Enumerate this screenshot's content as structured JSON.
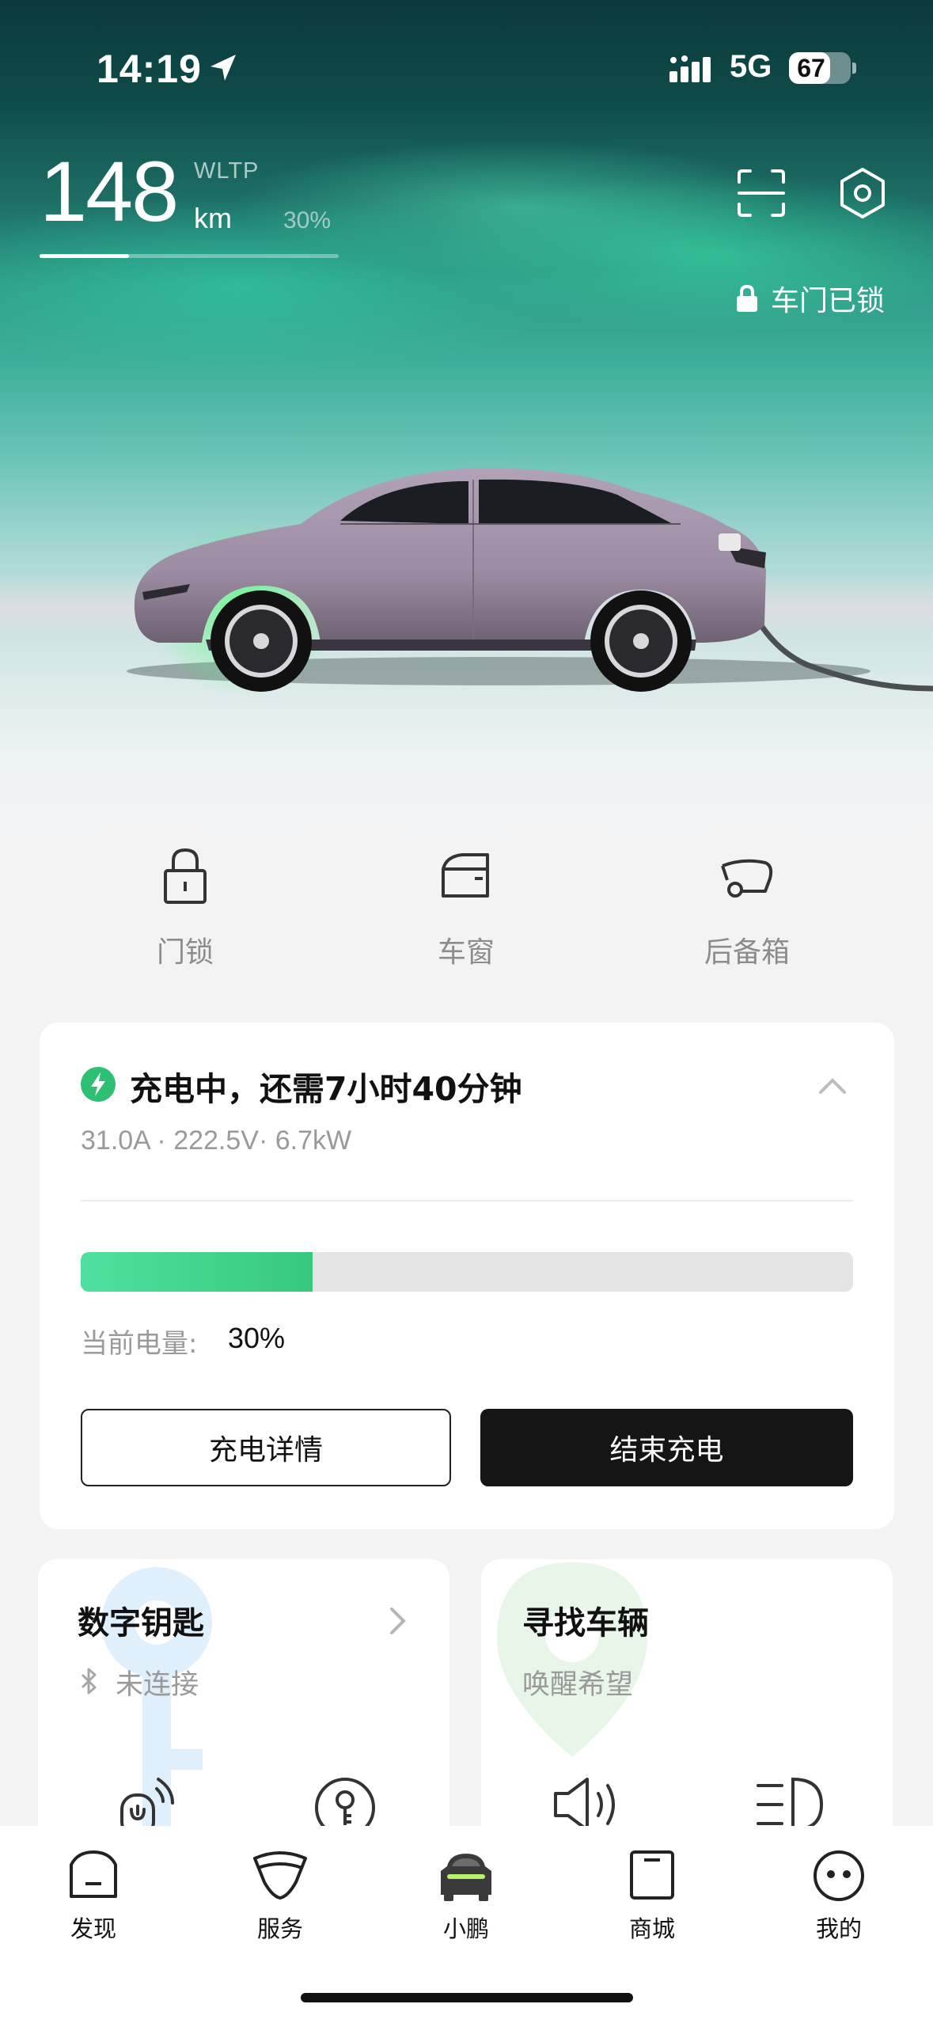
{
  "status_bar": {
    "time": "14:19",
    "network": "5G",
    "battery_level": "67",
    "battery_fraction": 0.67
  },
  "range": {
    "value": "148",
    "standard": "WLTP",
    "unit": "km",
    "battery_percent": "30%",
    "battery_fraction": 0.3
  },
  "lock_status": "车门已锁",
  "quick_controls": [
    "门锁",
    "车窗",
    "后备箱"
  ],
  "charging": {
    "title": "充电中，还需7小时40分钟",
    "meta": "31.0A · 222.5V· 6.7kW",
    "progress_fraction": 0.3,
    "soc_label": "当前电量:",
    "soc_value": "30%",
    "detail_button": "充电详情",
    "end_button": "结束充电",
    "accent_color": "#37c97b"
  },
  "digital_key": {
    "title": "数字钥匙",
    "status": "未连接"
  },
  "find_car": {
    "title": "寻找车辆",
    "subtitle": "唤醒希望"
  },
  "tabs": [
    "发现",
    "服务",
    "小鹏",
    "商城",
    "我的"
  ],
  "icons": {
    "navigation": "location-arrow-icon",
    "scan": "scan-icon",
    "settings": "settings-icon",
    "lock": "lock-icon",
    "window": "window-icon",
    "trunk": "trunk-icon",
    "bolt": "bolt-icon",
    "bluetooth": "bluetooth-icon"
  }
}
